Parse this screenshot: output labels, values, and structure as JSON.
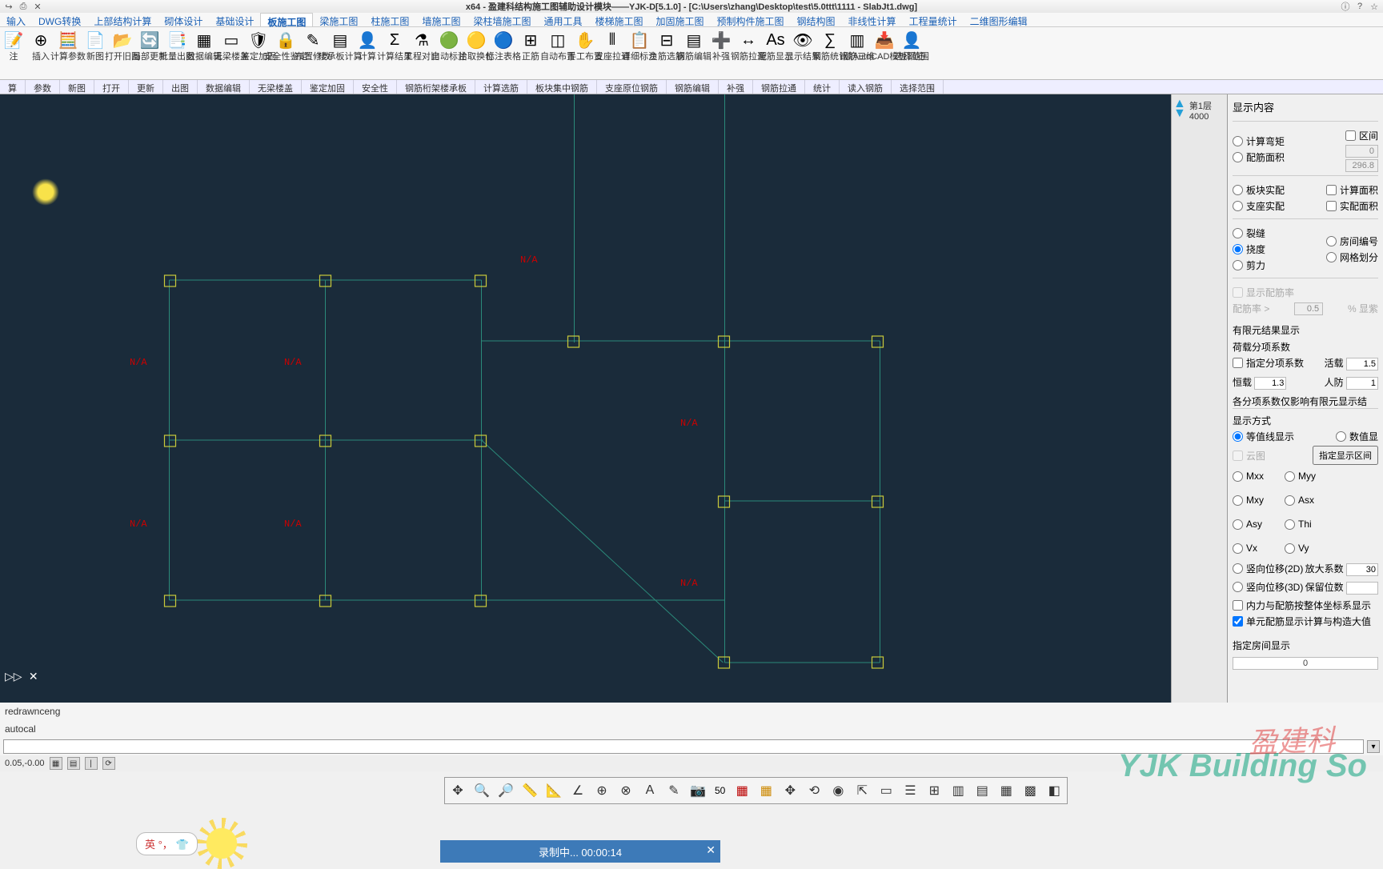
{
  "title": "x64 - 盈建科结构施工图辅助设计模块——YJK-D[5.1.0] - [C:\\Users\\zhang\\Desktop\\test\\5.0ttt\\1111 - SlabJt1.dwg]",
  "menus": [
    "输入",
    "DWG转换",
    "上部结构计算",
    "砌体设计",
    "基础设计",
    "板施工图",
    "梁施工图",
    "柱施工图",
    "墙施工图",
    "梁柱墙施工图",
    "通用工具",
    "楼梯施工图",
    "加固施工图",
    "预制构件施工图",
    "钢结构图",
    "非线性计算",
    "工程量统计",
    "二维图形编辑"
  ],
  "active_menu_index": 5,
  "ribbon": [
    {
      "label": "注",
      "sub": ""
    },
    {
      "label": "插入",
      "sub": ""
    },
    {
      "label": "计算参数",
      "sub": ""
    },
    {
      "label": "新图",
      "sub": ""
    },
    {
      "label": "打开旧图",
      "sub": ""
    },
    {
      "label": "局部更新",
      "sub": ""
    },
    {
      "label": "批量出图",
      "sub": ""
    },
    {
      "label": "数据编辑",
      "sub": ""
    },
    {
      "label": "无梁楼盖",
      "sub": ""
    },
    {
      "label": "鉴定加固",
      "sub": ""
    },
    {
      "label": "安全性鉴定",
      "sub": ""
    },
    {
      "label": "布置修改",
      "sub": ""
    },
    {
      "label": "楼承板计算",
      "sub": ""
    },
    {
      "label": "计算",
      "sub": ""
    },
    {
      "label": "计算结果",
      "sub": ""
    },
    {
      "label": "工程对比",
      "sub": ""
    },
    {
      "label": "自动标注",
      "sub": ""
    },
    {
      "label": "拾取换位",
      "sub": ""
    },
    {
      "label": "标注表格",
      "sub": ""
    },
    {
      "label": "正筋",
      "sub": ""
    },
    {
      "label": "自动布置",
      "sub": ""
    },
    {
      "label": "手工布置",
      "sub": ""
    },
    {
      "label": "支座拉通",
      "sub": ""
    },
    {
      "label": "详细标注",
      "sub": ""
    },
    {
      "label": "负筋选筋",
      "sub": ""
    },
    {
      "label": "钢筋编辑",
      "sub": ""
    },
    {
      "label": "补强",
      "sub": ""
    },
    {
      "label": "钢筋拉通",
      "sub": ""
    },
    {
      "label": "配筋显示",
      "sub": "As"
    },
    {
      "label": "显示结果",
      "sub": ""
    },
    {
      "label": "钢筋统计",
      "sub": ""
    },
    {
      "label": "钢筋三维",
      "sub": ""
    },
    {
      "label": "读AutoCAD模板钢筋",
      "sub": ""
    },
    {
      "label": "选择范围",
      "sub": ""
    }
  ],
  "sublabels": [
    "算",
    "参数",
    "新图",
    "打开",
    "更新",
    "出图",
    "数据编辑",
    "无梁楼盖",
    "鉴定加固",
    "安全性",
    "钢筋桁架楼承板",
    "计算选筋",
    "板块集中钢筋",
    "支座原位钢筋",
    "钢筋编辑",
    "补强",
    "钢筋拉通",
    "统计",
    "读入钢筋",
    "选择范围"
  ],
  "page_info": "第1层 4000",
  "na_labels": [
    "N/A",
    "N/A",
    "N/A",
    "N/A",
    "N/A",
    "N/A",
    "N/A"
  ],
  "cmd_marker": "▷▷ ✕",
  "right_panel": {
    "title": "显示内容",
    "g1": {
      "r1": "计算弯矩",
      "r2": "配筋面积",
      "chk": "区间",
      "v1": "0",
      "v2": "296.8"
    },
    "g2": {
      "r1": "板块实配",
      "r2": "支座实配",
      "c1": "计算面积",
      "c2": "实配面积"
    },
    "g3": {
      "r1": "裂缝",
      "r2": "挠度",
      "r3": "剪力",
      "c1": "房间编号",
      "c2": "网格划分"
    },
    "reinf": {
      "chk": "显示配筋率",
      "label": "配筋率 >",
      "val": "0.5",
      "suffix": "% 显紫"
    },
    "fem_title": "有限元结果显示",
    "coef_title": "荷载分项系数",
    "coef": {
      "chk": "指定分项系数",
      "live_lbl": "活载",
      "live": "1.5",
      "dead_lbl": "恒载",
      "dead": "1.3",
      "def_lbl": "人防",
      "def": "1"
    },
    "note": "各分项系数仅影响有限元显示结",
    "disp_title": "显示方式",
    "disp": {
      "r1": "等值线显示",
      "r2": "数值显",
      "c1": "云图",
      "btn": "指定显示区间"
    },
    "axes": [
      "Mxx",
      "Myy",
      "Mxy",
      "Asx",
      "Asy",
      "Thi",
      "Vx",
      "Vy"
    ],
    "d2d": {
      "lbl": "竖向位移(2D)",
      "amp_lbl": "放大系数",
      "amp": "30"
    },
    "d3d": {
      "lbl": "竖向位移(3D)",
      "dec_lbl": "保留位数",
      "dec": ""
    },
    "chk_force": "内力与配筋按整体坐标系显示",
    "chk_unit": "单元配筋显示计算与构造大值",
    "room_title": "指定房间显示",
    "room_val": "0"
  },
  "bottom_cmd1": "redrawnceng",
  "bottom_cmd2": "autocal",
  "coords": "0.05,-0.00",
  "ime_text": "英 °，",
  "tool_num": "50",
  "recording": "录制中... 00:00:14",
  "watermark": "盈建科"
}
